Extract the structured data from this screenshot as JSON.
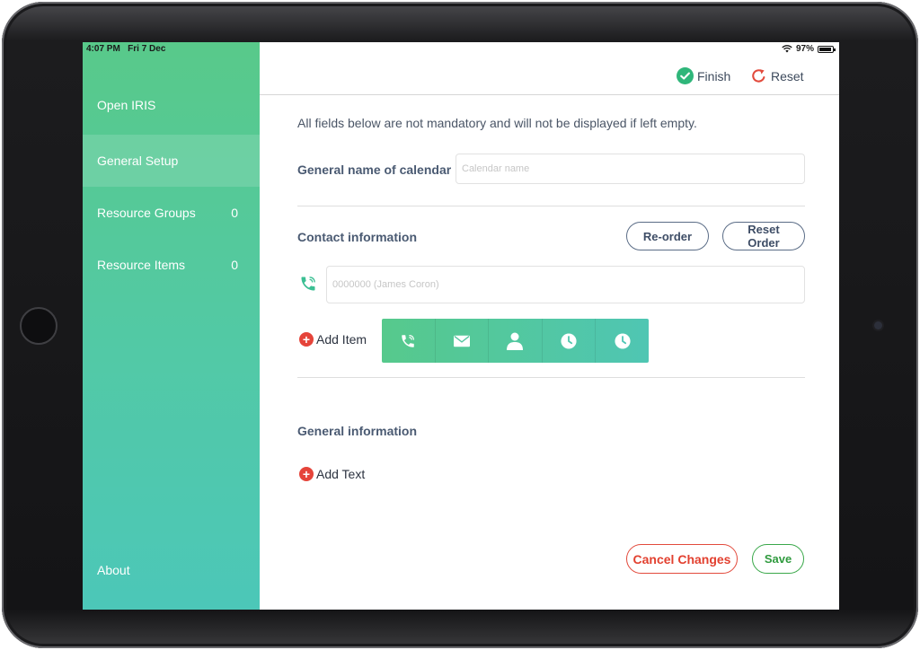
{
  "status_bar": {
    "time": "4:07 PM",
    "date": "Fri 7 Dec",
    "battery": "97%"
  },
  "sidebar": {
    "items": [
      {
        "label": "Open IRIS",
        "count": ""
      },
      {
        "label": "General Setup",
        "count": ""
      },
      {
        "label": "Resource Groups",
        "count": "0"
      },
      {
        "label": "Resource Items",
        "count": "0"
      }
    ],
    "about": "About",
    "active_index": 1
  },
  "topbar": {
    "finish_label": "Finish",
    "reset_label": "Reset"
  },
  "form": {
    "note": "All fields below are not mandatory and will not be displayed if left empty.",
    "calendar_name_label": "General name of calendar",
    "calendar_name_placeholder": "Calendar name",
    "calendar_name_value": "",
    "contact_section_label": "Contact information",
    "reorder_label": "Re-order",
    "reset_order_label": "Reset Order",
    "phone_placeholder": "0000000 (James Coron)",
    "phone_value": "",
    "add_item_label": "Add Item",
    "add_item_icons": [
      "phone-icon",
      "envelope-icon",
      "person-icon",
      "clock-icon",
      "clock-icon"
    ],
    "general_section_label": "General information",
    "add_text_label": "Add Text",
    "cancel_label": "Cancel Changes",
    "save_label": "Save"
  },
  "colors": {
    "sidebar_top": "#58c98a",
    "sidebar_bottom": "#4cc7b8",
    "finish_green": "#2fb67a",
    "reset_red": "#e24a3c",
    "cancel_red": "#e2402f",
    "save_green": "#2f9a3e",
    "label_blue": "#4a5a72"
  }
}
